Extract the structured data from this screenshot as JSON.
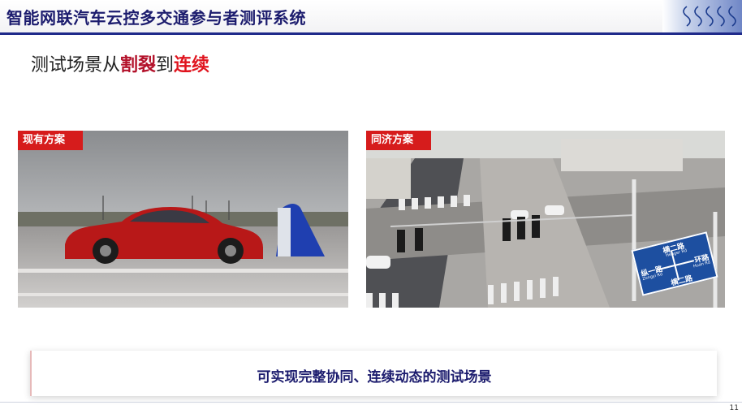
{
  "header": {
    "title": "智能网联汽车云控多交通参与者测评系统",
    "logo_icon": "university-seal-logo"
  },
  "subtitle": {
    "part1": "测试场景从",
    "part2": "割裂",
    "part3": "到",
    "part4": "连续"
  },
  "left_panel": {
    "label": "现有方案",
    "image": "red-car-test-track-photo"
  },
  "right_panel": {
    "label": "同济方案",
    "image": "aerial-intersection-photo",
    "sign": {
      "top": "横二路",
      "top_sub": "Henger Rd",
      "left": "纵一路",
      "left_sub": "Zongyi Rd",
      "right": "环路",
      "right_sub": "Huan Rd",
      "bottom": "横二路"
    }
  },
  "caption": {
    "text": "可实现完整协同、连续动态的测试场景"
  },
  "footer": {
    "page_number": "11"
  },
  "colors": {
    "brand_navy": "#1f2a8a",
    "label_red": "#d61c1c",
    "accent_red": "#e0141e"
  }
}
